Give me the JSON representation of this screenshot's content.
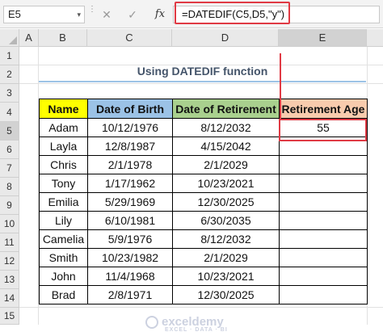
{
  "formula_bar": {
    "name_box": "E5",
    "name_box_arrow": "▾",
    "cancel_glyph": "✕",
    "enter_glyph": "✓",
    "fx_glyph": "fx",
    "formula": "=DATEDIF(C5,D5,\"y\")"
  },
  "columns": [
    "A",
    "B",
    "C",
    "D",
    "E"
  ],
  "rows": [
    "1",
    "2",
    "3",
    "4",
    "5",
    "6",
    "7",
    "8",
    "9",
    "10",
    "11",
    "12",
    "13",
    "14",
    "15"
  ],
  "title": "Using DATEDIF function",
  "table": {
    "headers": [
      "Name",
      "Date of Birth",
      "Date of Retirement",
      "Retirement Age"
    ],
    "rows": [
      {
        "name": "Adam",
        "dob": "10/12/1976",
        "dor": "8/12/2032",
        "age": "55"
      },
      {
        "name": "Layla",
        "dob": "12/8/1987",
        "dor": "4/15/2042",
        "age": ""
      },
      {
        "name": "Chris",
        "dob": "2/1/1978",
        "dor": "2/1/2029",
        "age": ""
      },
      {
        "name": "Tony",
        "dob": "1/17/1962",
        "dor": "10/23/2021",
        "age": ""
      },
      {
        "name": "Emilia",
        "dob": "5/29/1969",
        "dor": "12/30/2025",
        "age": ""
      },
      {
        "name": "Lily",
        "dob": "6/10/1981",
        "dor": "6/30/2035",
        "age": ""
      },
      {
        "name": "Camelia",
        "dob": "5/9/1976",
        "dor": "8/12/2032",
        "age": ""
      },
      {
        "name": "Smith",
        "dob": "10/23/1982",
        "dor": "2/1/2029",
        "age": ""
      },
      {
        "name": "John",
        "dob": "11/4/1968",
        "dor": "10/23/2021",
        "age": ""
      },
      {
        "name": "Brad",
        "dob": "2/8/1971",
        "dor": "12/30/2025",
        "age": ""
      }
    ]
  },
  "watermark": {
    "brand": "exceldemy",
    "tagline": "EXCEL · DATA · BI"
  },
  "colors": {
    "name_header": "#ffff00",
    "dob_header": "#9bc2e6",
    "dor_header": "#a9d08e",
    "age_header": "#f8cbad",
    "highlight": "#e03a44"
  }
}
